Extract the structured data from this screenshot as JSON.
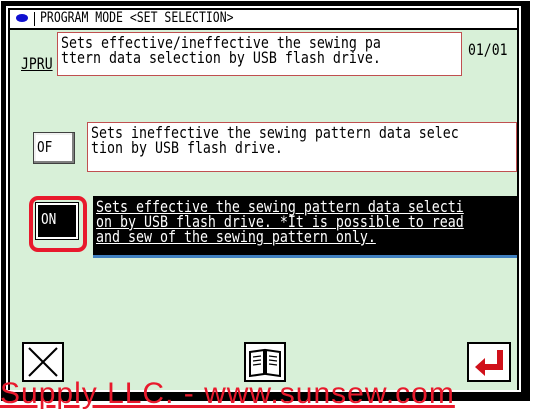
{
  "header": {
    "title": "PROGRAM MODE <SET SELECTION>"
  },
  "page_indicator": "01/01",
  "current": {
    "code": "JPRU",
    "description": "Sets effective/ineffective the sewing pa\nttern data selection by USB flash drive."
  },
  "options": [
    {
      "label": "OF",
      "description": "Sets ineffective the sewing pattern data selec\ntion by USB flash drive.",
      "selected": false
    },
    {
      "label": "ON",
      "description": "Sets effective the sewing pattern data selecti\non by USB flash drive. *It is possible to read\nand sew of the sewing pattern only.",
      "selected": true
    }
  ],
  "buttons": {
    "cancel_icon": "close-x-icon",
    "manual_icon": "book-icon",
    "enter_icon": "enter-arrow-icon"
  },
  "watermark": "Supply LLC. - www.sunsew.com",
  "colors": {
    "panel_bg": "#d8f0d8",
    "highlight_red": "#e8192c",
    "enter_arrow_red": "#d0101a",
    "title_dot_blue": "#1010d0"
  }
}
